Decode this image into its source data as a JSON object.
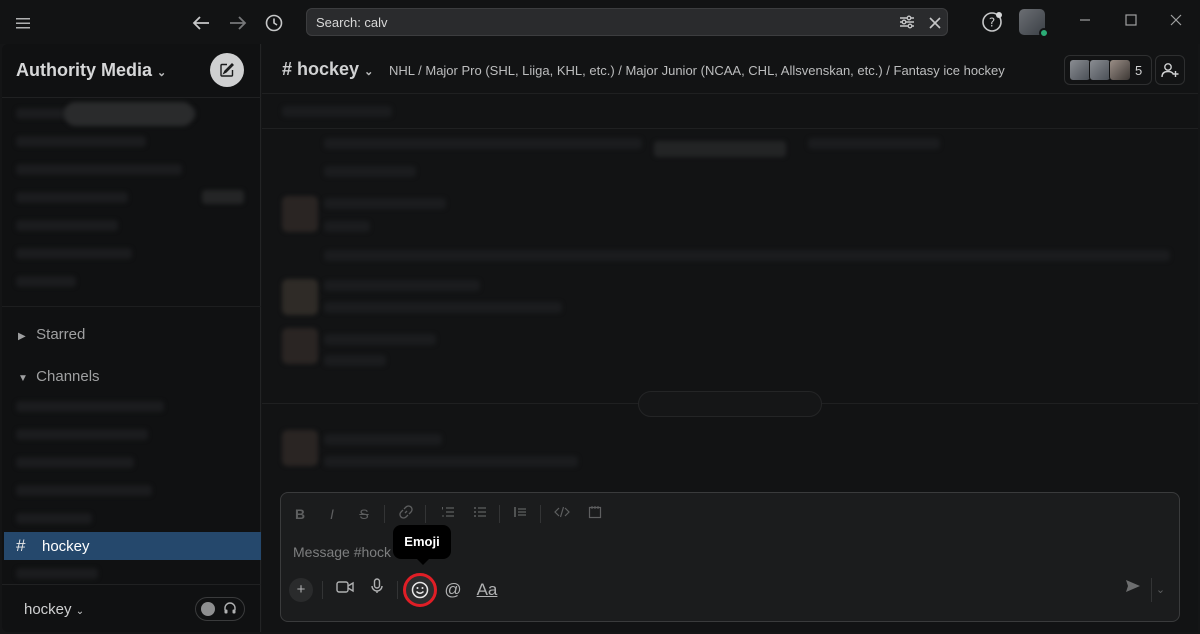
{
  "titlebar": {
    "search_text": "Search: calv",
    "icons": [
      "menu-icon",
      "back-arrow-icon",
      "forward-arrow-icon",
      "history-icon",
      "filter-icon",
      "clear-icon",
      "help-icon"
    ]
  },
  "sidebar": {
    "workspace_name": "Authority Media",
    "sections": {
      "starred": "Starred",
      "channels": "Channels"
    },
    "active_channel": "hockey",
    "footer_label": "hockey"
  },
  "channel": {
    "name": "hockey",
    "topic": "NHL / Major Pro (SHL, Liiga, KHL, etc.) / Major Junior (NCAA, CHL, Allsvenskan, etc.) / Fantasy ice hockey",
    "member_count": "5"
  },
  "composer": {
    "placeholder": "Message #hock",
    "tooltip": "Emoji",
    "text_format_label": "Aa"
  },
  "colors": {
    "active_channel_bg": "#25486c",
    "emoji_highlight": "#e01e26",
    "presence": "#2bac76"
  }
}
